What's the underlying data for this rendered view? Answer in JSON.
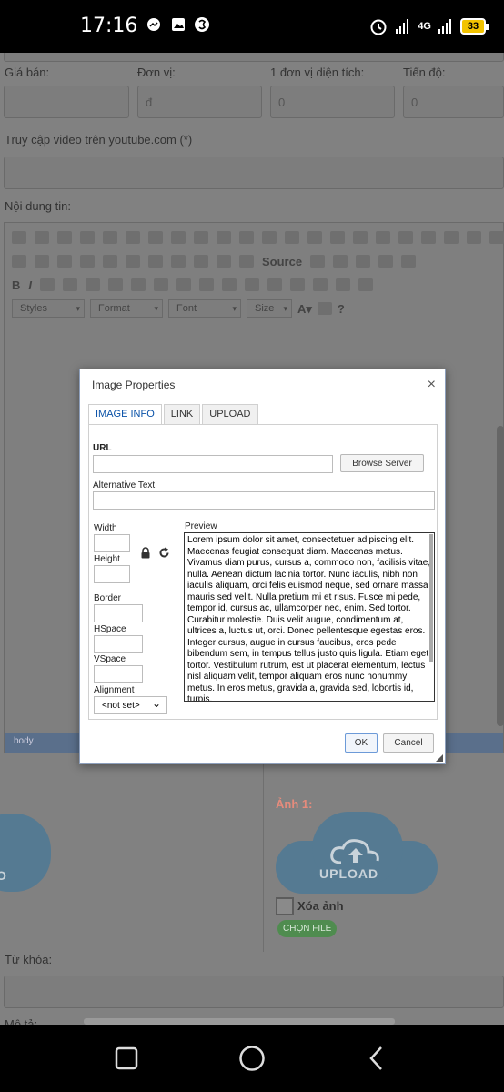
{
  "status": {
    "time": "17:16",
    "network": "4G",
    "battery": "33"
  },
  "form": {
    "price_label": "Giá bán:",
    "unit_label": "Đơn vị:",
    "unit_value": "đ",
    "area_unit_label": "1 đơn vị diện tích:",
    "area_unit_value": "0",
    "progress_label": "Tiến độ:",
    "progress_value": "0",
    "video_label": "Truy cập video trên youtube.com (*)",
    "content_label": "Nội dung tin:",
    "keywords_label": "Từ khóa:",
    "description_label": "Mô tả:"
  },
  "editor": {
    "source_label": "Source",
    "styles_combo": "Styles",
    "format_combo": "Format",
    "font_combo": "Font",
    "size_combo": "Size",
    "path": "body"
  },
  "upload": {
    "image1_label": "Ảnh 1:",
    "upload_text": "UPLOAD",
    "delete_label": "Xóa ảnh",
    "choose_file": "CHỌN FILE",
    "accent": "#e58b7c"
  },
  "dialog": {
    "title": "Image Properties",
    "close": "×",
    "tabs": [
      {
        "label": "IMAGE INFO"
      },
      {
        "label": "LINK"
      },
      {
        "label": "UPLOAD"
      }
    ],
    "url_label": "URL",
    "browse_label": "Browse Server",
    "alt_label": "Alternative Text",
    "width_label": "Width",
    "height_label": "Height",
    "border_label": "Border",
    "hspace_label": "HSpace",
    "vspace_label": "VSpace",
    "alignment_label": "Alignment",
    "alignment_value": "<not set>",
    "preview_label": "Preview",
    "preview_text": "Lorem ipsum dolor sit amet, consectetuer adipiscing elit. Maecenas feugiat consequat diam. Maecenas metus. Vivamus diam purus, cursus a, commodo non, facilisis vitae, nulla. Aenean dictum lacinia tortor. Nunc iaculis, nibh non iaculis aliquam, orci felis euismod neque, sed ornare massa mauris sed velit. Nulla pretium mi et risus. Fusce mi pede, tempor id, cursus ac, ullamcorper nec, enim. Sed tortor. Curabitur molestie. Duis velit augue, condimentum at, ultrices a, luctus ut, orci. Donec pellentesque egestas eros. Integer cursus, augue in cursus faucibus, eros pede bibendum sem, in tempus tellus justo quis ligula. Etiam eget tortor. Vestibulum rutrum, est ut placerat elementum, lectus nisl aliquam velit, tempor aliquam eros nunc nonummy metus. In eros metus, gravida a, gravida sed, lobortis id, turpis.",
    "ok_label": "OK",
    "cancel_label": "Cancel"
  }
}
